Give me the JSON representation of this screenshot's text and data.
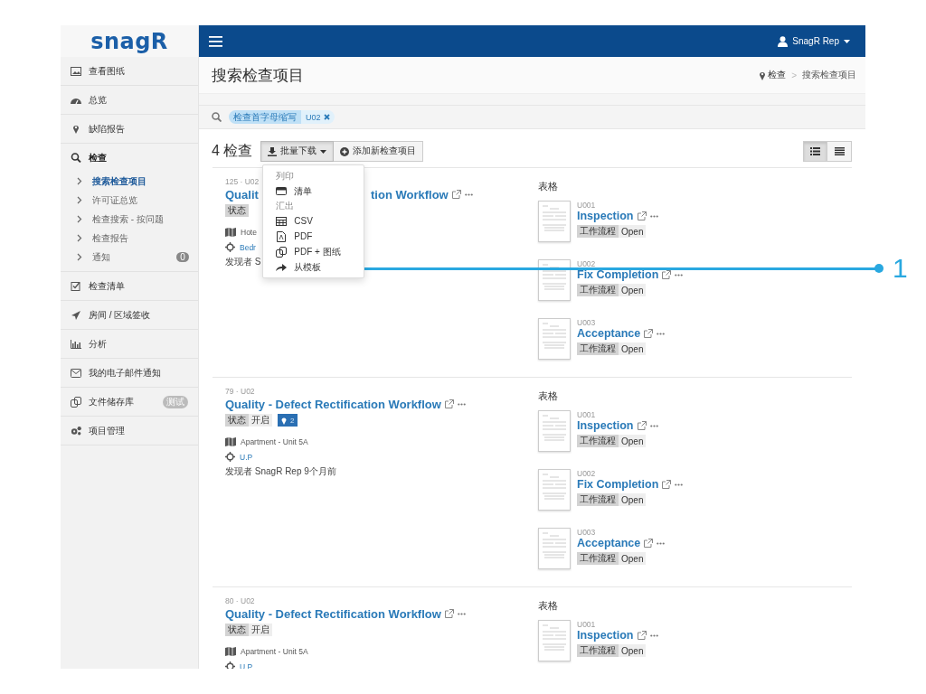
{
  "logo": {
    "text": "snagR"
  },
  "topbar": {
    "user": "SnagR Rep"
  },
  "sidebar": {
    "items": [
      {
        "label": "查看图纸"
      },
      {
        "label": "总览"
      },
      {
        "label": "缺陷报告"
      },
      {
        "label": "检查",
        "expanded": true,
        "children": [
          {
            "label": "搜索检查项目",
            "selected": true
          },
          {
            "label": "许可证总览",
            "selected": false
          },
          {
            "label": "检查搜索 - 按问题",
            "selected": false
          },
          {
            "label": "检查报告",
            "selected": false
          },
          {
            "label": "通知",
            "selected": false,
            "badge": "0"
          }
        ]
      },
      {
        "label": "检查清单"
      },
      {
        "label": "房间 / 区域签收"
      },
      {
        "label": "分析"
      },
      {
        "label": "我的电子邮件通知"
      },
      {
        "label": "文件储存库",
        "badge": "测试"
      },
      {
        "label": "项目管理"
      }
    ]
  },
  "page": {
    "title": "搜索检查项目",
    "breadcrumb": [
      "检查",
      "搜索检查项目"
    ],
    "breadcrumb_separator": ">"
  },
  "search": {
    "filter_label": "检查首字母缩写",
    "filter_value": "U02"
  },
  "toolbar": {
    "count": "4 检查",
    "bulk_button": "批量下载",
    "add_button": "添加新检查项目",
    "views": [
      {
        "selected": true
      },
      {
        "selected": false
      }
    ]
  },
  "bulk_menu": {
    "items": [
      {
        "kind": "header",
        "label": "列印"
      },
      {
        "kind": "item",
        "label": "清单"
      },
      {
        "kind": "header",
        "label": "汇出"
      },
      {
        "kind": "item",
        "label": "CSV"
      },
      {
        "kind": "item",
        "label": "PDF"
      },
      {
        "kind": "item",
        "label": "PDF + 图纸"
      },
      {
        "kind": "item",
        "label": "从模板"
      }
    ]
  },
  "records": [
    {
      "ref": "125 · U02",
      "title": "Qualit",
      "title_after": "tion Workflow",
      "status_label": "状态",
      "location": "Hote",
      "area": "Bedr",
      "found": "发现者 S",
      "forms_heading": "表格",
      "forms": [
        {
          "code": "U001",
          "name": "Inspection",
          "tag_label": "工作流程",
          "tag_value": "Open"
        },
        {
          "code": "U002",
          "name": "Fix Completion",
          "tag_label": "工作流程",
          "tag_value": "Open"
        },
        {
          "code": "U003",
          "name": "Acceptance",
          "tag_label": "工作流程",
          "tag_value": "Open"
        }
      ]
    },
    {
      "ref": "79 · U02",
      "title": "Quality - Defect Rectification Workflow",
      "status_label": "状态",
      "status_value": "开启",
      "pins": "2",
      "location": "Apartment - Unit 5A",
      "area": "U.P",
      "found": "发现者 SnagR Rep 9个月前",
      "forms_heading": "表格",
      "forms": [
        {
          "code": "U001",
          "name": "Inspection",
          "tag_label": "工作流程",
          "tag_value": "Open"
        },
        {
          "code": "U002",
          "name": "Fix Completion",
          "tag_label": "工作流程",
          "tag_value": "Open"
        },
        {
          "code": "U003",
          "name": "Acceptance",
          "tag_label": "工作流程",
          "tag_value": "Open"
        }
      ]
    },
    {
      "ref": "80 · U02",
      "title": "Quality - Defect Rectification Workflow",
      "status_label": "状态",
      "status_value": "开启",
      "location": "Apartment - Unit 5A",
      "area": "U.P",
      "forms_heading": "表格",
      "forms": [
        {
          "code": "U001",
          "name": "Inspection",
          "tag_label": "工作流程",
          "tag_value": "Open"
        }
      ]
    }
  ],
  "callout": {
    "label": "1"
  }
}
